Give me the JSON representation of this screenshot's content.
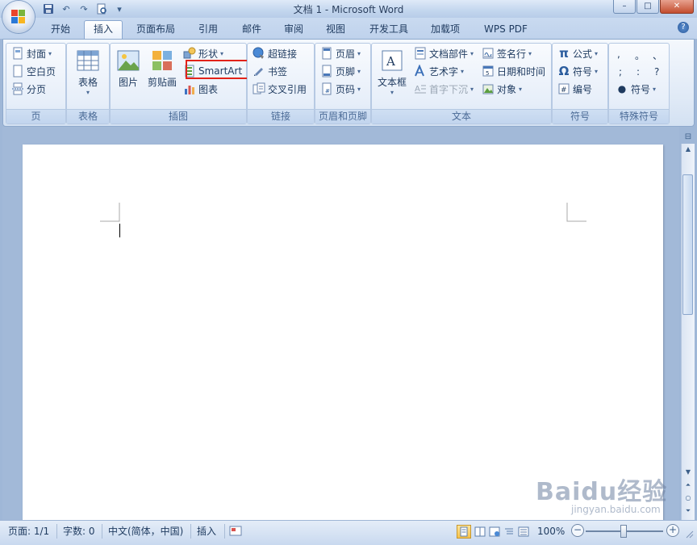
{
  "window": {
    "title": "文档 1 - Microsoft Word",
    "minimize": "–",
    "maximize": "□",
    "close": "✕"
  },
  "tabs": [
    {
      "label": "开始"
    },
    {
      "label": "插入",
      "active": true
    },
    {
      "label": "页面布局"
    },
    {
      "label": "引用"
    },
    {
      "label": "邮件"
    },
    {
      "label": "审阅"
    },
    {
      "label": "视图"
    },
    {
      "label": "开发工具"
    },
    {
      "label": "加载项"
    },
    {
      "label": "WPS PDF"
    }
  ],
  "groups": {
    "pages": {
      "label": "页",
      "cover": "封面",
      "blank": "空白页",
      "pagebreak": "分页"
    },
    "table": {
      "label": "表格",
      "table": "表格"
    },
    "illustrations": {
      "label": "插图",
      "picture": "图片",
      "clipart": "剪贴画",
      "shapes": "形状",
      "smartart": "SmartArt",
      "chart": "图表"
    },
    "links": {
      "label": "链接",
      "hyperlink": "超链接",
      "bookmark": "书签",
      "crossref": "交叉引用"
    },
    "header_footer": {
      "label": "页眉和页脚",
      "header": "页眉",
      "footer": "页脚",
      "pagenum": "页码"
    },
    "text": {
      "label": "文本",
      "textbox": "文本框",
      "quickparts": "文档部件",
      "wordart": "艺术字",
      "dropcap": "首字下沉",
      "signature": "签名行",
      "datetime": "日期和时间",
      "object": "对象"
    },
    "symbols": {
      "label": "符号",
      "equation": "公式",
      "symbol": "符号",
      "number": "编号"
    },
    "special": {
      "label": "特殊符号",
      "row1": [
        ",",
        "。",
        "、"
      ],
      "row2": [
        ";",
        ":",
        "?"
      ],
      "symbol": "符号"
    }
  },
  "status": {
    "page": "页面: 1/1",
    "words": "字数: 0",
    "language": "中文(简体，中国)",
    "mode": "插入",
    "zoom": "100%"
  },
  "watermark": {
    "main": "Baidu经验",
    "sub": "jingyan.baidu.com"
  },
  "colors": {
    "highlight": "#e2231a",
    "ribbon_bg": "#dfe9f6",
    "doc_bg": "#a2b9d8"
  }
}
